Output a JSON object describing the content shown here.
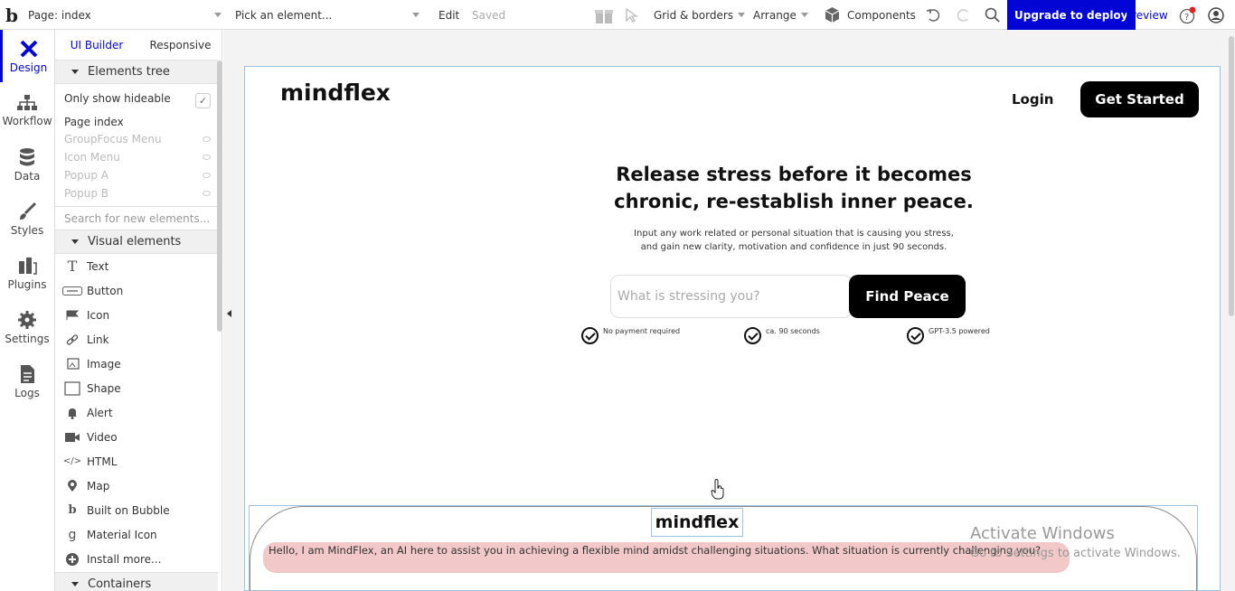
{
  "topbar": {
    "logo": "b",
    "page_label": "Page: index",
    "element_placeholder": "Pick an element...",
    "edit": "Edit",
    "saved": "Saved",
    "grid_borders": "Grid & borders",
    "arrange": "Arrange",
    "components": "Components",
    "upgrade": "Upgrade to deploy",
    "preview": "Preview"
  },
  "leftnav": [
    {
      "label": "Design",
      "icon": "design-icon"
    },
    {
      "label": "Workflow",
      "icon": "workflow-icon"
    },
    {
      "label": "Data",
      "icon": "data-icon"
    },
    {
      "label": "Styles",
      "icon": "brush-icon"
    },
    {
      "label": "Plugins",
      "icon": "plugins-icon"
    },
    {
      "label": "Settings",
      "icon": "gear-icon"
    },
    {
      "label": "Logs",
      "icon": "logs-icon"
    }
  ],
  "panel": {
    "tabs": {
      "ui_builder": "UI Builder",
      "responsive": "Responsive"
    },
    "elements_tree": "Elements tree",
    "only_show_hideable": "Only show hideable",
    "tree": [
      "Page index",
      "GroupFocus Menu",
      "Icon Menu",
      "Popup A",
      "Popup B"
    ],
    "search_placeholder": "Search for new elements...",
    "visual_elements": "Visual elements",
    "elements": [
      "Text",
      "Button",
      "Icon",
      "Link",
      "Image",
      "Shape",
      "Alert",
      "Video",
      "HTML",
      "Map",
      "Built on Bubble",
      "Material Icon",
      "Install more..."
    ],
    "containers": "Containers"
  },
  "site": {
    "brand": "mindflex",
    "login": "Login",
    "get_started": "Get Started",
    "hero_line1": "Release stress before it becomes",
    "hero_line2": "chronic, re-establish inner peace.",
    "sub_line1": "Input any work related or personal situation that is causing you stress,",
    "sub_line2": "and gain new clarity, motivation and confidence in just 90 seconds.",
    "input_placeholder": "What is stressing you?",
    "find_peace": "Find Peace",
    "perks": [
      "No payment required",
      "ca. 90 seconds",
      "GPT-3.5 powered"
    ],
    "chat_brand": "mindflex",
    "chat_message": "Hello, I am MindFlex, an AI here to assist you in achieving a flexible mind amidst challenging situations. What situation is currently challenging you?"
  },
  "watermark": {
    "line1": "Activate Windows",
    "line2": "Go to Settings to activate Windows."
  },
  "colors": {
    "accent": "#0205d3",
    "chat_bubble": "#f2c8c8",
    "button": "#000000"
  }
}
